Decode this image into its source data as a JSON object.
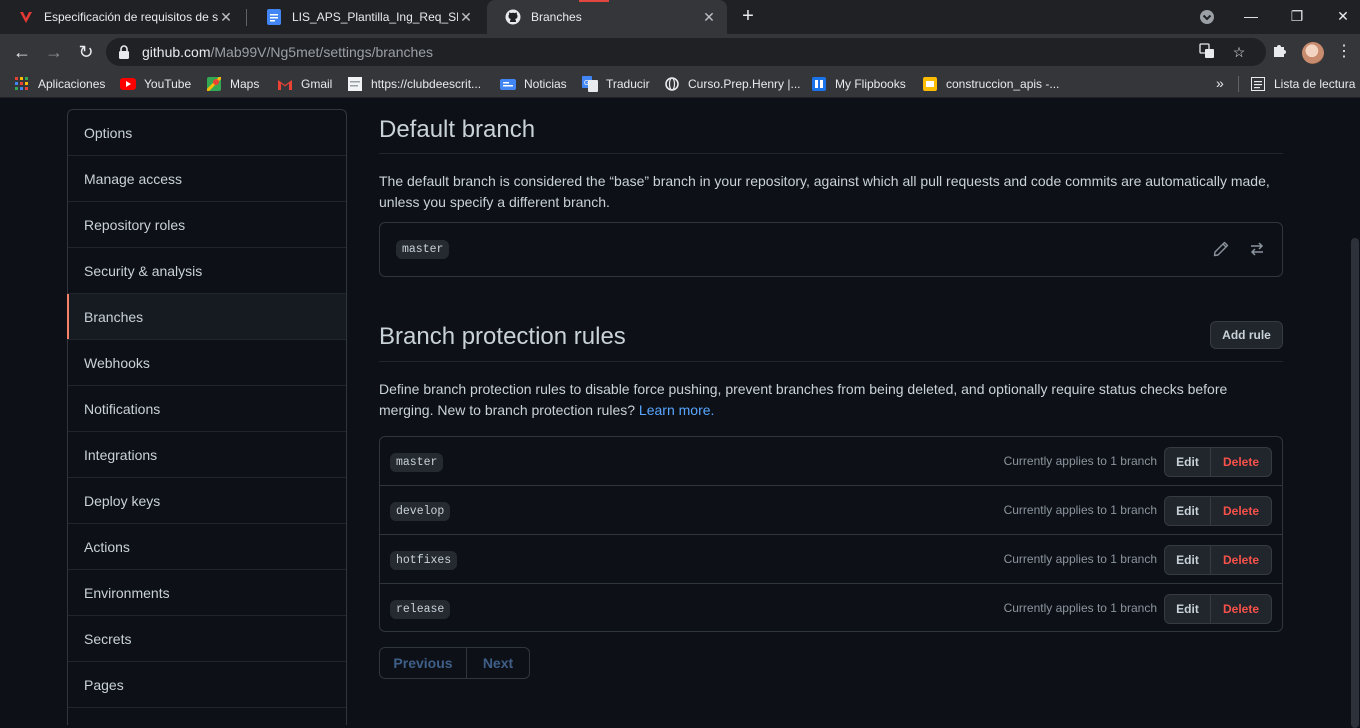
{
  "browser": {
    "tabs": [
      {
        "title": "Especificación de requisitos de so",
        "icon": "vivaldi-v-icon"
      },
      {
        "title": "LIS_APS_Plantilla_Ing_Req_SRS_v",
        "icon": "google-docs-icon"
      },
      {
        "title": "Branches",
        "icon": "github-icon",
        "active": true
      }
    ],
    "url_host": "github.com",
    "url_path": "/Mab99V/Ng5met/settings/branches",
    "bookmarks": [
      {
        "label": "Aplicaciones",
        "icon": "apps-grid-icon"
      },
      {
        "label": "YouTube",
        "icon": "youtube-icon"
      },
      {
        "label": "Maps",
        "icon": "maps-icon"
      },
      {
        "label": "Gmail",
        "icon": "gmail-icon"
      },
      {
        "label": "https://clubdeescrit...",
        "icon": "page-icon"
      },
      {
        "label": "Noticias",
        "icon": "news-icon"
      },
      {
        "label": "Traducir",
        "icon": "translate-icon"
      },
      {
        "label": "Curso.Prep.Henry |...",
        "icon": "globe-icon"
      },
      {
        "label": "My Flipbooks",
        "icon": "flipbooks-icon"
      },
      {
        "label": "construccion_apis -...",
        "icon": "slides-icon"
      }
    ],
    "reading_list": "Lista de lectura",
    "colors": {
      "accent_tab_line": "#e0473e",
      "toolbar": "#35363a",
      "tabstrip": "#202124"
    }
  },
  "sidebar": {
    "items": [
      {
        "label": "Options"
      },
      {
        "label": "Manage access"
      },
      {
        "label": "Repository roles"
      },
      {
        "label": "Security & analysis"
      },
      {
        "label": "Branches",
        "selected": true
      },
      {
        "label": "Webhooks"
      },
      {
        "label": "Notifications"
      },
      {
        "label": "Integrations"
      },
      {
        "label": "Deploy keys"
      },
      {
        "label": "Actions"
      },
      {
        "label": "Environments"
      },
      {
        "label": "Secrets"
      },
      {
        "label": "Pages"
      }
    ]
  },
  "default_branch": {
    "title": "Default branch",
    "description": "The default branch is considered the “base” branch in your repository, against which all pull requests and code commits are automatically made, unless you specify a different branch.",
    "branch": "master"
  },
  "protection": {
    "title": "Branch protection rules",
    "add_rule_label": "Add rule",
    "description": "Define branch protection rules to disable force pushing, prevent branches from being deleted, and optionally require status checks before merging. New to branch protection rules?",
    "learn_more": "Learn more.",
    "edit_label": "Edit",
    "delete_label": "Delete",
    "rules": [
      {
        "branch": "master",
        "applies": "Currently applies to 1 branch"
      },
      {
        "branch": "develop",
        "applies": "Currently applies to 1 branch"
      },
      {
        "branch": "hotfixes",
        "applies": "Currently applies to 1 branch"
      },
      {
        "branch": "release",
        "applies": "Currently applies to 1 branch"
      }
    ]
  },
  "pagination": {
    "previous": "Previous",
    "next": "Next"
  },
  "theme": {
    "bg": "#0d1117",
    "border": "#30363d",
    "link": "#58a6ff",
    "danger": "#f85149",
    "selected_marker": "#f78166"
  }
}
